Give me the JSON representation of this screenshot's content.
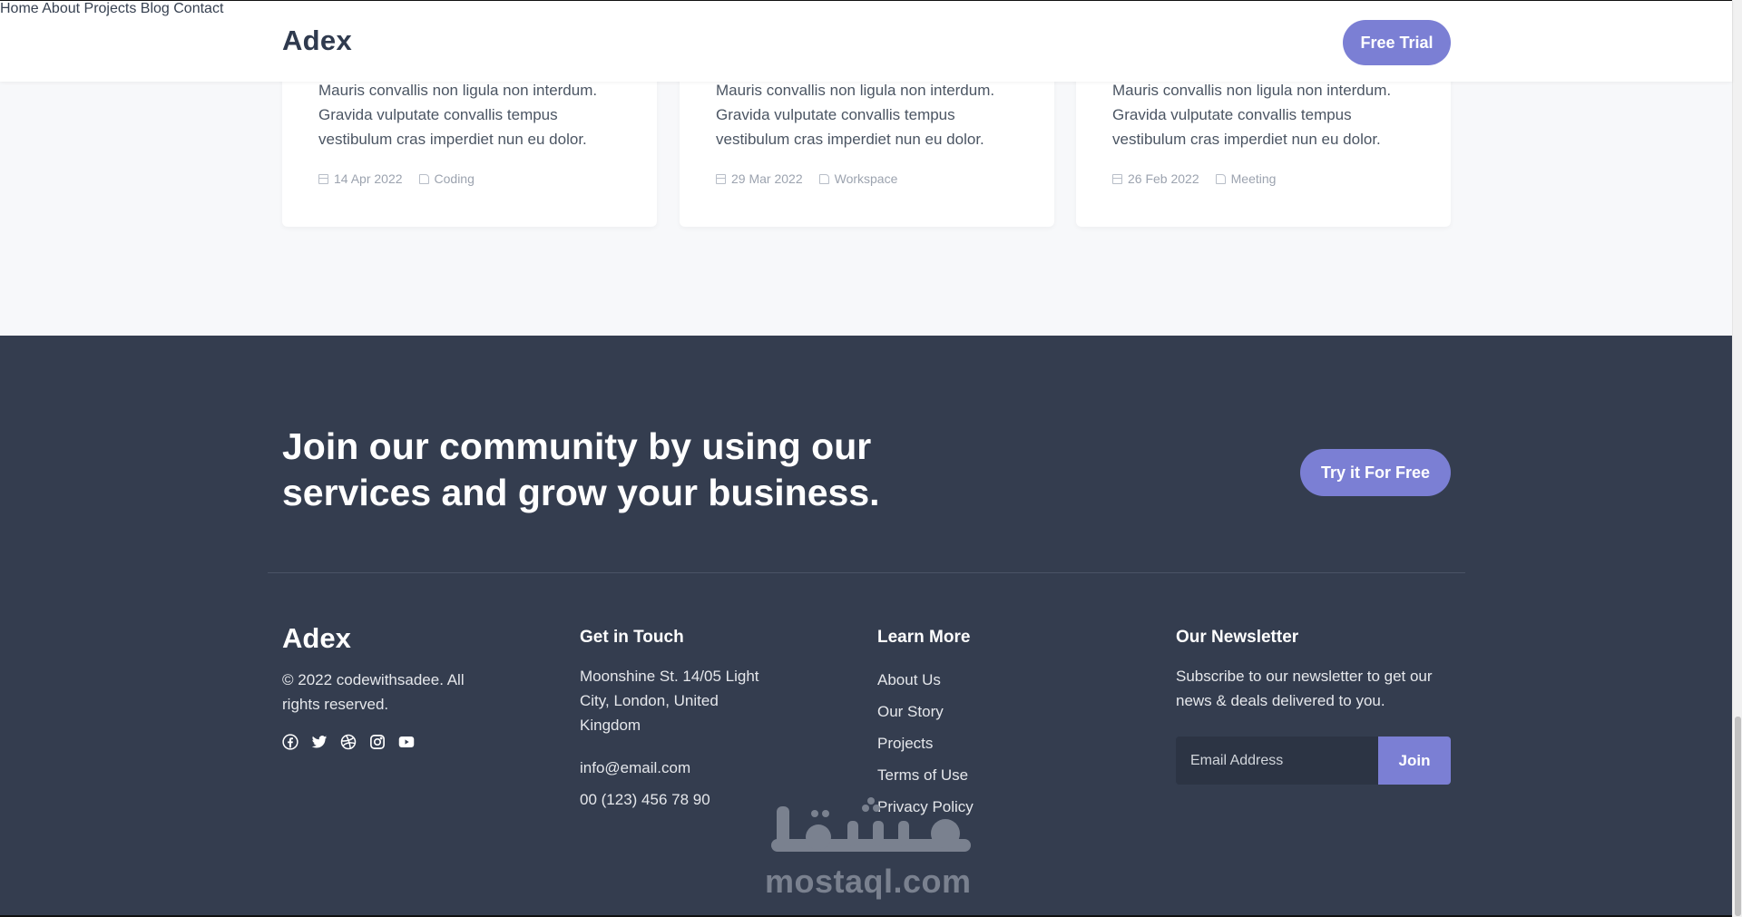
{
  "header": {
    "logo": "Adex",
    "nav": [
      "Home",
      "About",
      "Projects",
      "Blog",
      "Contact"
    ],
    "cta": "Free Trial"
  },
  "cards": [
    {
      "text": "Mauris convallis non ligula non interdum. Gravida vulputate convallis tempus vestibulum cras imperdiet nun eu dolor.",
      "date": "14 Apr 2022",
      "category": "Coding"
    },
    {
      "text": "Mauris convallis non ligula non interdum. Gravida vulputate convallis tempus vestibulum cras imperdiet nun eu dolor.",
      "date": "29 Mar 2022",
      "category": "Workspace"
    },
    {
      "text": "Mauris convallis non ligula non interdum. Gravida vulputate convallis tempus vestibulum cras imperdiet nun eu dolor.",
      "date": "26 Feb 2022",
      "category": "Meeting"
    }
  ],
  "footer": {
    "cta_heading": "Join our community by using our services and grow your business.",
    "cta_button": "Try it For Free",
    "logo": "Adex",
    "copyright": "© 2022 codewithsadee. All rights reserved.",
    "socials": [
      "facebook-icon",
      "twitter-icon",
      "dribbble-icon",
      "instagram-icon",
      "youtube-icon"
    ],
    "contact": {
      "title": "Get in Touch",
      "address": "Moonshine St. 14/05 Light City, London, United Kingdom",
      "email": "info@email.com",
      "phone": "00 (123) 456 78 90"
    },
    "learn": {
      "title": "Learn More",
      "links": [
        "About Us",
        "Our Story",
        "Projects",
        "Terms of Use",
        "Privacy Policy"
      ]
    },
    "newsletter": {
      "title": "Our Newsletter",
      "text": "Subscribe to our newsletter to get our news & deals delivered to you.",
      "placeholder": "Email Address",
      "button": "Join"
    }
  },
  "watermark": {
    "arabic": "مستقل",
    "latin": "mostaql.com"
  },
  "colors": {
    "accent": "#7b7fd4",
    "footer_bg": "#343d4f",
    "header_text": "#2f3a4e"
  }
}
